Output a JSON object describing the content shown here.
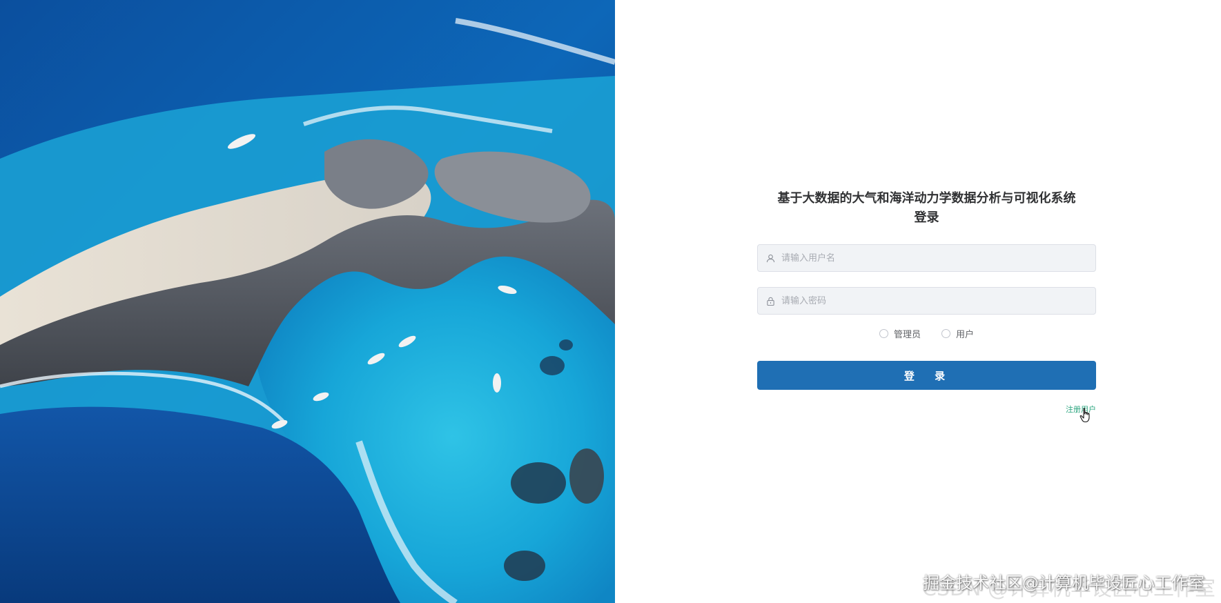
{
  "login": {
    "title": "基于大数据的大气和海洋动力学数据分析与可视化系统",
    "subtitle": "登录",
    "username_placeholder": "请输入用户名",
    "password_placeholder": "请输入密码",
    "roles": [
      "管理员",
      "用户"
    ],
    "login_button": "登 录",
    "register_link": "注册用户"
  },
  "icons": {
    "username": "user-icon",
    "password": "lock-icon",
    "pointer": "hand-pointer-icon"
  },
  "watermark": {
    "text": "掘金技术社区@计算机毕设匠心工作室",
    "ghost_text": "CSDN @计算机毕设匠心工作室"
  },
  "colors": {
    "primary": "#1f6fb4",
    "link": "#2ba57f",
    "input_bg": "#f1f3f6"
  }
}
